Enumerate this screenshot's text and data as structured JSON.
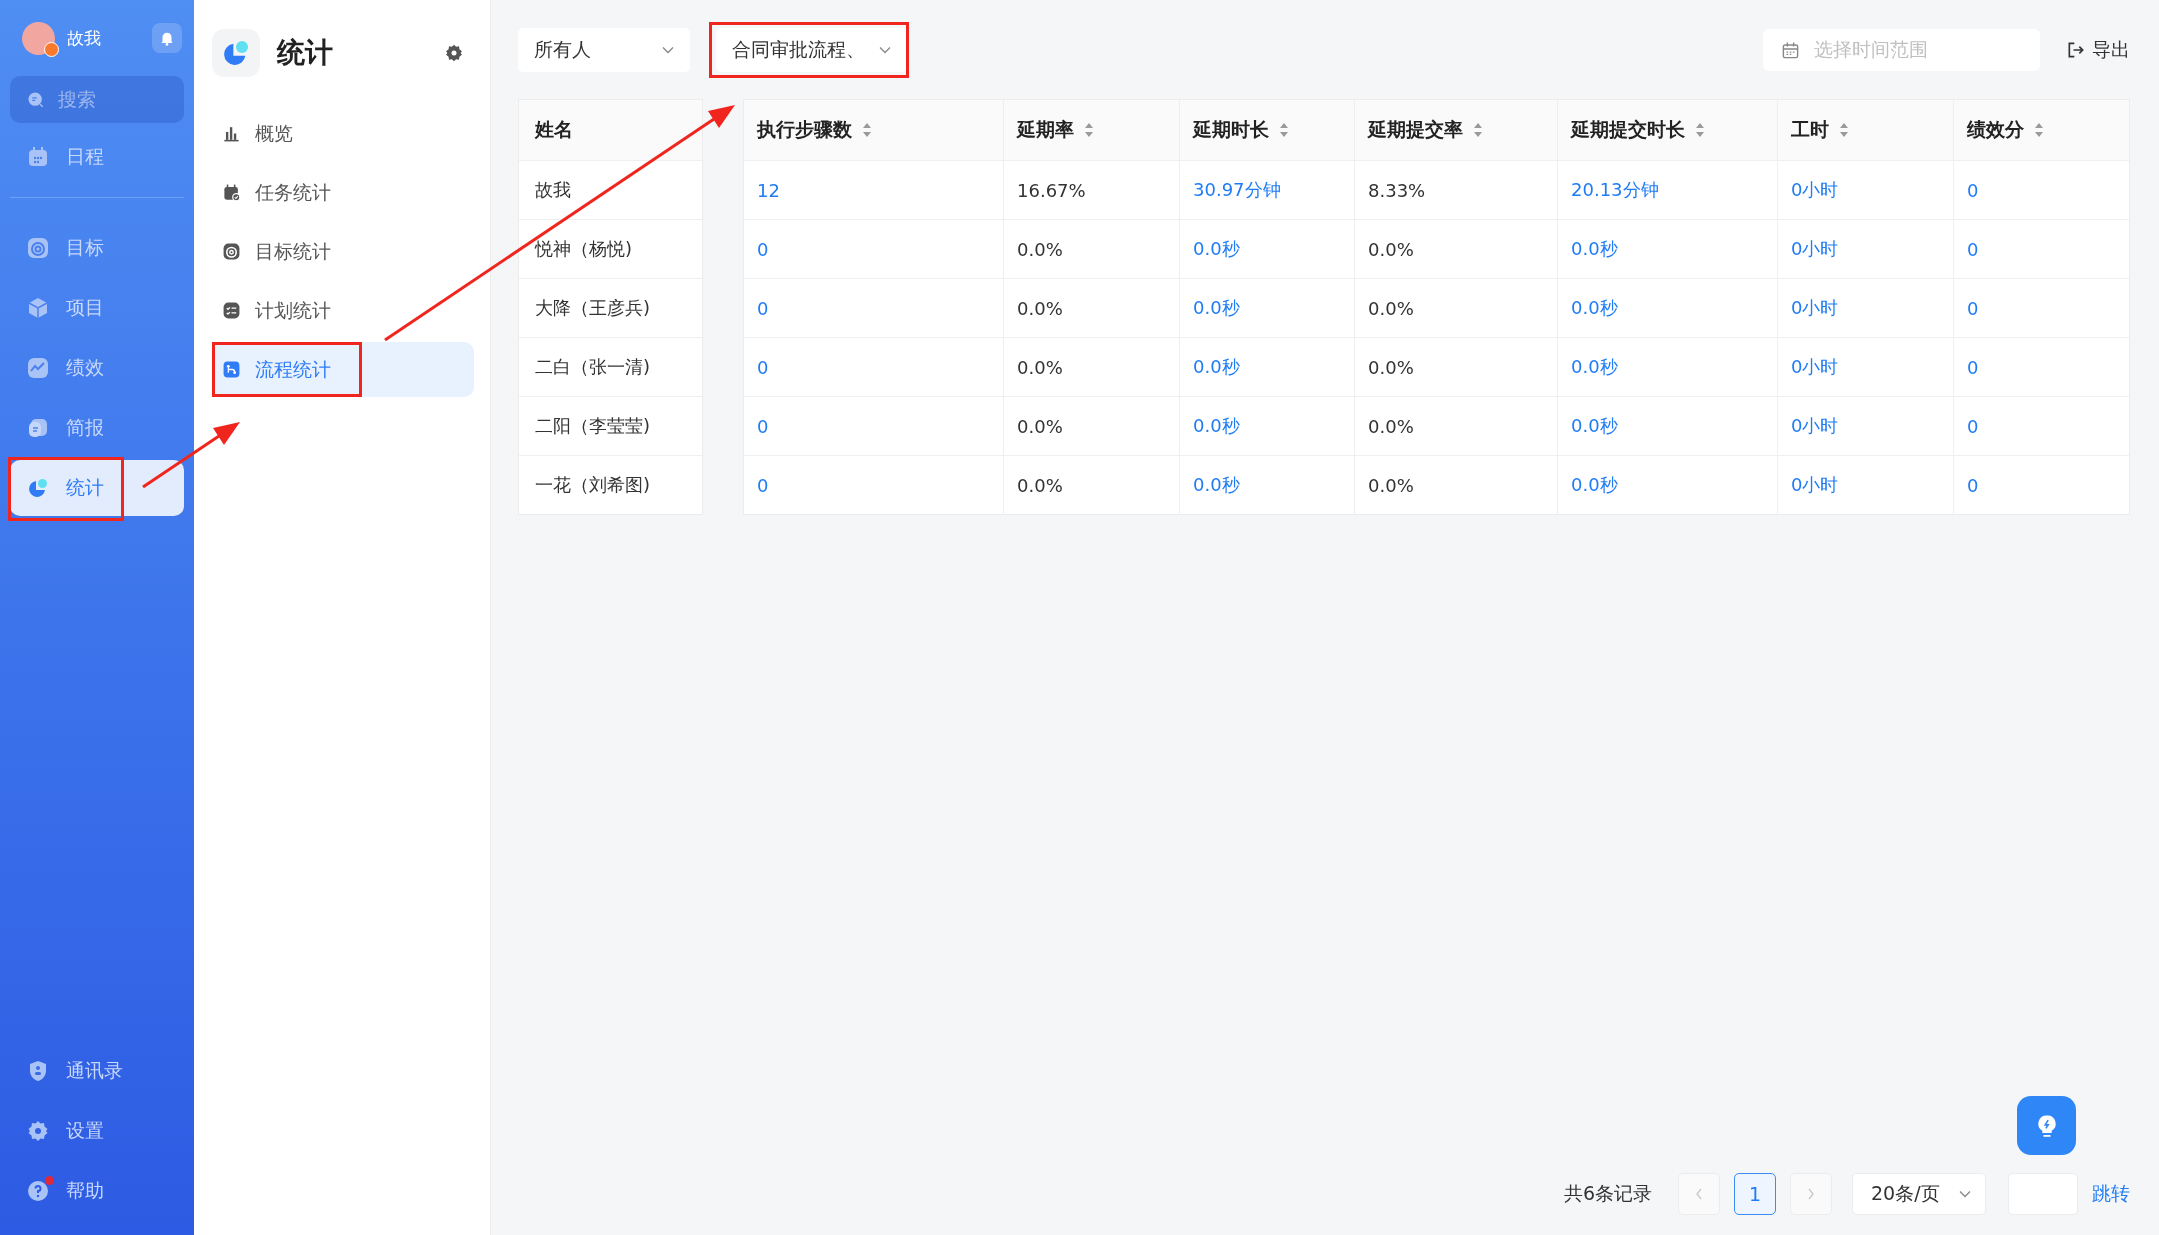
{
  "sidebar": {
    "user": {
      "name": "故我"
    },
    "search": {
      "placeholder": "搜索"
    },
    "primary_items": [
      {
        "label": "日程",
        "selected": false,
        "highlighted": false,
        "badge": false
      }
    ],
    "modules": [
      {
        "label": "目标",
        "selected": false,
        "highlighted": false,
        "badge": false
      },
      {
        "label": "项目",
        "selected": false,
        "highlighted": false,
        "badge": false
      },
      {
        "label": "绩效",
        "selected": false,
        "highlighted": false,
        "badge": false
      },
      {
        "label": "简报",
        "selected": false,
        "highlighted": false,
        "badge": false
      },
      {
        "label": "统计",
        "selected": true,
        "highlighted": true,
        "badge": false
      }
    ],
    "footer_items": [
      {
        "label": "通讯录",
        "selected": false,
        "highlighted": false,
        "badge": false
      },
      {
        "label": "设置",
        "selected": false,
        "highlighted": false,
        "badge": false
      },
      {
        "label": "帮助",
        "selected": false,
        "highlighted": false,
        "badge": true
      }
    ]
  },
  "stats_nav": {
    "title": "统计",
    "items": [
      {
        "label": "概览",
        "selected": false,
        "highlighted": false
      },
      {
        "label": "任务统计",
        "selected": false,
        "highlighted": false
      },
      {
        "label": "目标统计",
        "selected": false,
        "highlighted": false
      },
      {
        "label": "计划统计",
        "selected": false,
        "highlighted": false
      },
      {
        "label": "流程统计",
        "selected": true,
        "highlighted": true
      }
    ]
  },
  "filters": {
    "selects": [
      {
        "value": "所有人",
        "highlighted": false
      },
      {
        "value": "合同审批流程、",
        "highlighted": true
      }
    ],
    "date_range": {
      "placeholder": "选择时间范围"
    },
    "export": "导出"
  },
  "table": {
    "name_column": "姓名",
    "columns": [
      {
        "label": "执行步骤数",
        "kind": "link"
      },
      {
        "label": "延期率",
        "kind": "text"
      },
      {
        "label": "延期时长",
        "kind": "link"
      },
      {
        "label": "延期提交率",
        "kind": "text"
      },
      {
        "label": "延期提交时长",
        "kind": "link"
      },
      {
        "label": "工时",
        "kind": "link"
      },
      {
        "label": "绩效分",
        "kind": "link"
      }
    ],
    "rows": [
      {
        "name": "故我",
        "cells": [
          "12",
          "16.67%",
          "30.97分钟",
          "8.33%",
          "20.13分钟",
          "0小时",
          "0"
        ]
      },
      {
        "name": "悦神（杨悦)",
        "cells": [
          "0",
          "0.0%",
          "0.0秒",
          "0.0%",
          "0.0秒",
          "0小时",
          "0"
        ]
      },
      {
        "name": "大降（王彦兵)",
        "cells": [
          "0",
          "0.0%",
          "0.0秒",
          "0.0%",
          "0.0秒",
          "0小时",
          "0"
        ]
      },
      {
        "name": "二白（张一清)",
        "cells": [
          "0",
          "0.0%",
          "0.0秒",
          "0.0%",
          "0.0秒",
          "0小时",
          "0"
        ]
      },
      {
        "name": "二阳（李莹莹)",
        "cells": [
          "0",
          "0.0%",
          "0.0秒",
          "0.0%",
          "0.0秒",
          "0小时",
          "0"
        ]
      },
      {
        "name": "一花（刘希图)",
        "cells": [
          "0",
          "0.0%",
          "0.0秒",
          "0.0%",
          "0.0秒",
          "0小时",
          "0"
        ]
      }
    ]
  },
  "pagination": {
    "total": "共6条记录",
    "pages": [
      {
        "label": "1",
        "selected": true
      }
    ],
    "page_size": "20条/页",
    "jump": "跳转"
  }
}
